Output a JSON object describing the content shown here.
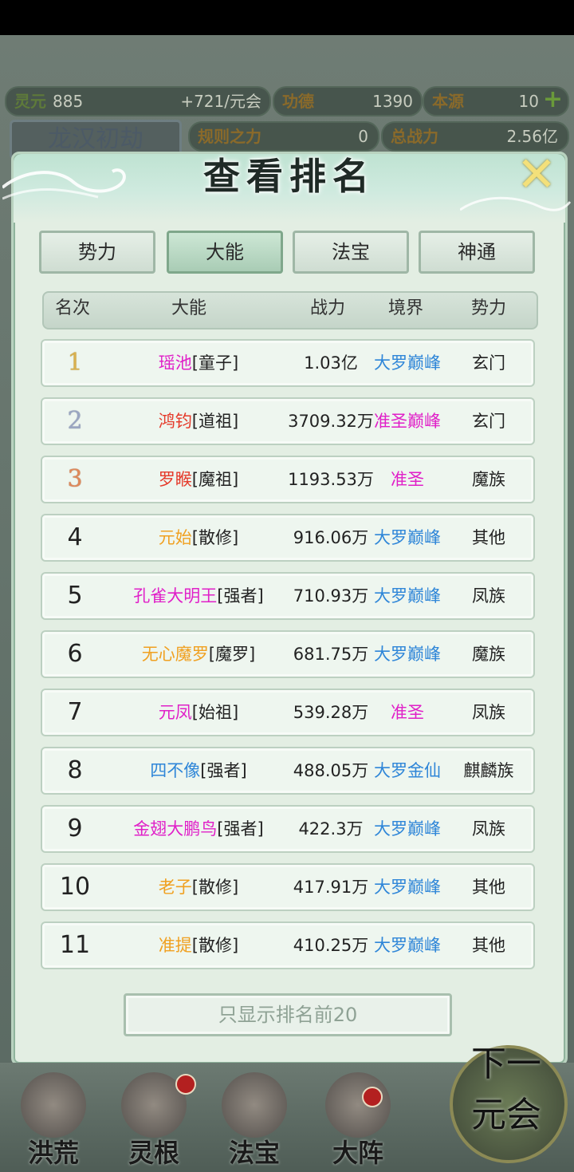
{
  "resources": {
    "lingyuan_label": "灵元",
    "lingyuan_value": "885",
    "rate": "+721/元会",
    "gongde_label": "功德",
    "gongde_value": "1390",
    "benyuan_label": "本源",
    "benyuan_value": "10",
    "guize_label": "规则之力",
    "guize_value": "0",
    "zhanli_label": "总战力",
    "zhanli_value": "2.56亿",
    "ghost_title": "龙汉初劫"
  },
  "dialog": {
    "title": "查看排名",
    "close_icon": "close-x-icon",
    "tabs": [
      {
        "label": "势力",
        "active": false
      },
      {
        "label": "大能",
        "active": true
      },
      {
        "label": "法宝",
        "active": false
      },
      {
        "label": "神通",
        "active": false
      }
    ],
    "headers": {
      "rank": "名次",
      "name": "大能",
      "power": "战力",
      "realm": "境界",
      "faction": "势力"
    },
    "rows": [
      {
        "rank": "1",
        "name": "瑶池",
        "title": "[童子]",
        "name_color": "#e020c8",
        "power": "1.03亿",
        "realm": "大罗巅峰",
        "realm_color": "#2f86d8",
        "faction": "玄门"
      },
      {
        "rank": "2",
        "name": "鸿钧",
        "title": "[道祖]",
        "name_color": "#e53a2a",
        "power": "3709.32万",
        "realm": "准圣巅峰",
        "realm_color": "#e020c8",
        "faction": "玄门"
      },
      {
        "rank": "3",
        "name": "罗睺",
        "title": "[魔祖]",
        "name_color": "#e53a2a",
        "power": "1193.53万",
        "realm": "准圣",
        "realm_color": "#e020c8",
        "faction": "魔族"
      },
      {
        "rank": "4",
        "name": "元始",
        "title": "[散修]",
        "name_color": "#f0a020",
        "power": "916.06万",
        "realm": "大罗巅峰",
        "realm_color": "#2f86d8",
        "faction": "其他"
      },
      {
        "rank": "5",
        "name": "孔雀大明王",
        "title": "[强者]",
        "name_color": "#e020c8",
        "power": "710.93万",
        "realm": "大罗巅峰",
        "realm_color": "#2f86d8",
        "faction": "凤族"
      },
      {
        "rank": "6",
        "name": "无心魔罗",
        "title": "[魔罗]",
        "name_color": "#f0a020",
        "power": "681.75万",
        "realm": "大罗巅峰",
        "realm_color": "#2f86d8",
        "faction": "魔族"
      },
      {
        "rank": "7",
        "name": "元凤",
        "title": "[始祖]",
        "name_color": "#e020c8",
        "power": "539.28万",
        "realm": "准圣",
        "realm_color": "#e020c8",
        "faction": "凤族"
      },
      {
        "rank": "8",
        "name": "四不像",
        "title": "[强者]",
        "name_color": "#2f86d8",
        "power": "488.05万",
        "realm": "大罗金仙",
        "realm_color": "#2f86d8",
        "faction": "麒麟族"
      },
      {
        "rank": "9",
        "name": "金翅大鹏鸟",
        "title": "[强者]",
        "name_color": "#e020c8",
        "power": "422.3万",
        "realm": "大罗巅峰",
        "realm_color": "#2f86d8",
        "faction": "凤族"
      },
      {
        "rank": "10",
        "name": "老子",
        "title": "[散修]",
        "name_color": "#f0a020",
        "power": "417.91万",
        "realm": "大罗巅峰",
        "realm_color": "#2f86d8",
        "faction": "其他"
      },
      {
        "rank": "11",
        "name": "准提",
        "title": "[散修]",
        "name_color": "#f0a020",
        "power": "410.25万",
        "realm": "大罗巅峰",
        "realm_color": "#2f86d8",
        "faction": "其他"
      }
    ],
    "bottom_button": "只显示排名前20"
  },
  "nav": {
    "items": [
      "洪荒",
      "灵根",
      "法宝",
      "大阵"
    ],
    "next_line1": "下一",
    "next_line2": "元会"
  }
}
